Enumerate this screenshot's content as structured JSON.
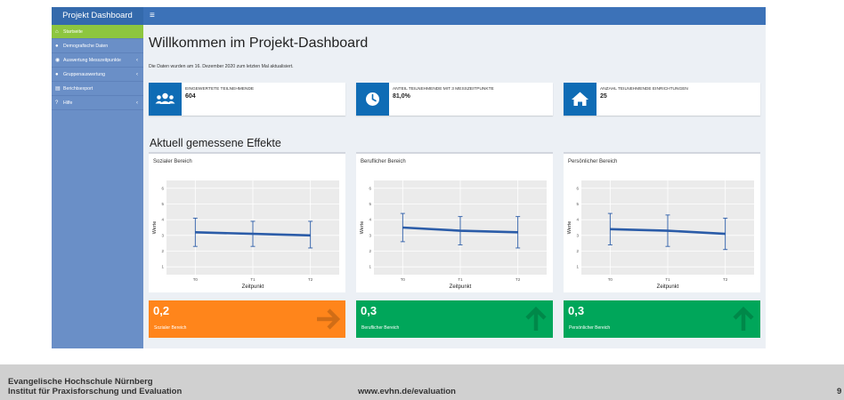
{
  "topbar": {
    "brand": "Projekt Dashboard",
    "menu_toggle_icon": "hamburger-icon",
    "menu_toggle_glyph": "≡"
  },
  "sidebar": {
    "items": [
      {
        "label": "Startseite",
        "icon": "home-icon",
        "glyph": "⌂",
        "has_submenu": false,
        "active": true
      },
      {
        "label": "Demografische Daten",
        "icon": "user-icon",
        "glyph": "●",
        "has_submenu": false,
        "active": false
      },
      {
        "label": "Auswertung Messzeitpunkte",
        "icon": "globe-icon",
        "glyph": "◉",
        "has_submenu": true,
        "active": false
      },
      {
        "label": "Gruppenauswertung",
        "icon": "users-icon",
        "glyph": "●",
        "has_submenu": true,
        "active": false
      },
      {
        "label": "Berichtsexport",
        "icon": "export-icon",
        "glyph": "▤",
        "has_submenu": false,
        "active": false
      },
      {
        "label": "Hilfe",
        "icon": "help-icon",
        "glyph": "?",
        "has_submenu": true,
        "active": false
      }
    ],
    "chevron_glyph": "‹"
  },
  "main": {
    "title": "Willkommen im Projekt-Dashboard",
    "update_note": "Die Daten wurden am 16. Dezember 2020 zum letzten Mal aktualisiert.",
    "infoboxes": [
      {
        "label": "EINGEWERTETE TEILNEHMENDE",
        "value": "604",
        "icon": "users-icon"
      },
      {
        "label": "ANTEIL TEILNEHMENDE MIT 3 MESSZEITPUNKTE",
        "value": "81,0%",
        "icon": "clock-icon"
      },
      {
        "label": "ANZAHL TEILNEHMENDE EINRICHTUNGEN",
        "value": "25",
        "icon": "home-icon"
      }
    ],
    "effects_title": "Aktuell gemessene Effekte",
    "valueboxes": [
      {
        "value": "0,2",
        "label": "Sozialer Bereich",
        "color": "#ff851b",
        "arrow": "arrow-right-icon"
      },
      {
        "value": "0,3",
        "label": "Beruflicher Bereich",
        "color": "#00a65a",
        "arrow": "arrow-up-icon"
      },
      {
        "value": "0,3",
        "label": "Persönlicher Bereich",
        "color": "#00a65a",
        "arrow": "arrow-up-icon"
      }
    ]
  },
  "chart_data": [
    {
      "type": "line",
      "title": "Sozialer Bereich",
      "xlabel": "Zeitpunkt",
      "ylabel": "Werte",
      "categories": [
        "T0",
        "T1",
        "T2"
      ],
      "values": [
        3.2,
        3.1,
        3.0
      ],
      "error_low": [
        2.3,
        2.3,
        2.2
      ],
      "error_high": [
        4.1,
        3.9,
        3.9
      ],
      "ylim": [
        0.5,
        6.5
      ],
      "yticks": [
        1,
        2,
        3,
        4,
        5,
        6
      ],
      "grid": true,
      "line_color": "#2b5ca8"
    },
    {
      "type": "line",
      "title": "Beruflicher Bereich",
      "xlabel": "Zeitpunkt",
      "ylabel": "Werte",
      "categories": [
        "T0",
        "T1",
        "T2"
      ],
      "values": [
        3.5,
        3.3,
        3.2
      ],
      "error_low": [
        2.6,
        2.4,
        2.2
      ],
      "error_high": [
        4.4,
        4.2,
        4.2
      ],
      "ylim": [
        0.5,
        6.5
      ],
      "yticks": [
        1,
        2,
        3,
        4,
        5,
        6
      ],
      "grid": true,
      "line_color": "#2b5ca8"
    },
    {
      "type": "line",
      "title": "Persönlicher Bereich",
      "xlabel": "Zeitpunkt",
      "ylabel": "Werte",
      "categories": [
        "T0",
        "T1",
        "T2"
      ],
      "values": [
        3.4,
        3.3,
        3.1
      ],
      "error_low": [
        2.4,
        2.3,
        2.1
      ],
      "error_high": [
        4.4,
        4.3,
        4.1
      ],
      "ylim": [
        0.5,
        6.5
      ],
      "yticks": [
        1,
        2,
        3,
        4,
        5,
        6
      ],
      "grid": true,
      "line_color": "#2b5ca8"
    }
  ],
  "footer": {
    "line1": "Evangelische Hochschule Nürnberg",
    "line2": "Institut für Praxisforschung und Evaluation",
    "url": "www.evhn.de/evaluation",
    "page": "9"
  }
}
